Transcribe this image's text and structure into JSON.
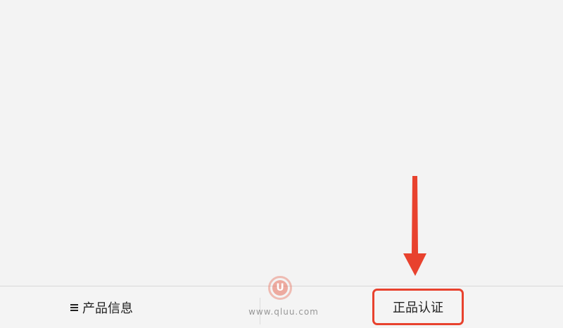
{
  "bottom_bar": {
    "product_info_label": "产品信息",
    "authentication_label": "正品认证",
    "menu_icon": "hamburger-menu-icon"
  },
  "watermark": {
    "logo_letter": "U",
    "site": "www.qluu.com"
  },
  "annotation": {
    "arrow_color": "#e8422e",
    "highlight_color": "#e8422e"
  }
}
